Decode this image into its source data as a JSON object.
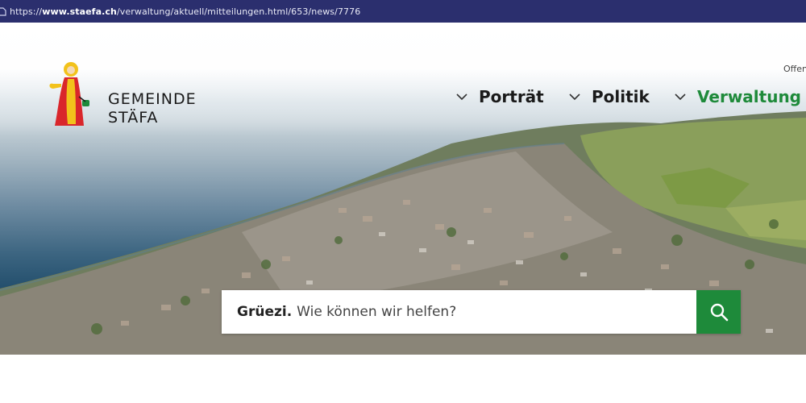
{
  "browser": {
    "url_prefix": "https://",
    "url_domain": "www.staefa.ch",
    "url_path": "/verwaltung/aktuell/mitteilungen.html/653/news/7776"
  },
  "header": {
    "logo_line1": "GEMEINDE",
    "logo_line2": "STÄFA",
    "top_link": "Offen"
  },
  "nav": {
    "items": [
      {
        "label": "Porträt",
        "active": false
      },
      {
        "label": "Politik",
        "active": false
      },
      {
        "label": "Verwaltung",
        "active": true
      }
    ]
  },
  "search": {
    "greeting": "Grüezi.",
    "placeholder": "Wie können wir helfen?",
    "button_icon": "search-icon"
  },
  "colors": {
    "accent_green": "#1e8a3a",
    "browser_bar": "#2b2f6e"
  }
}
